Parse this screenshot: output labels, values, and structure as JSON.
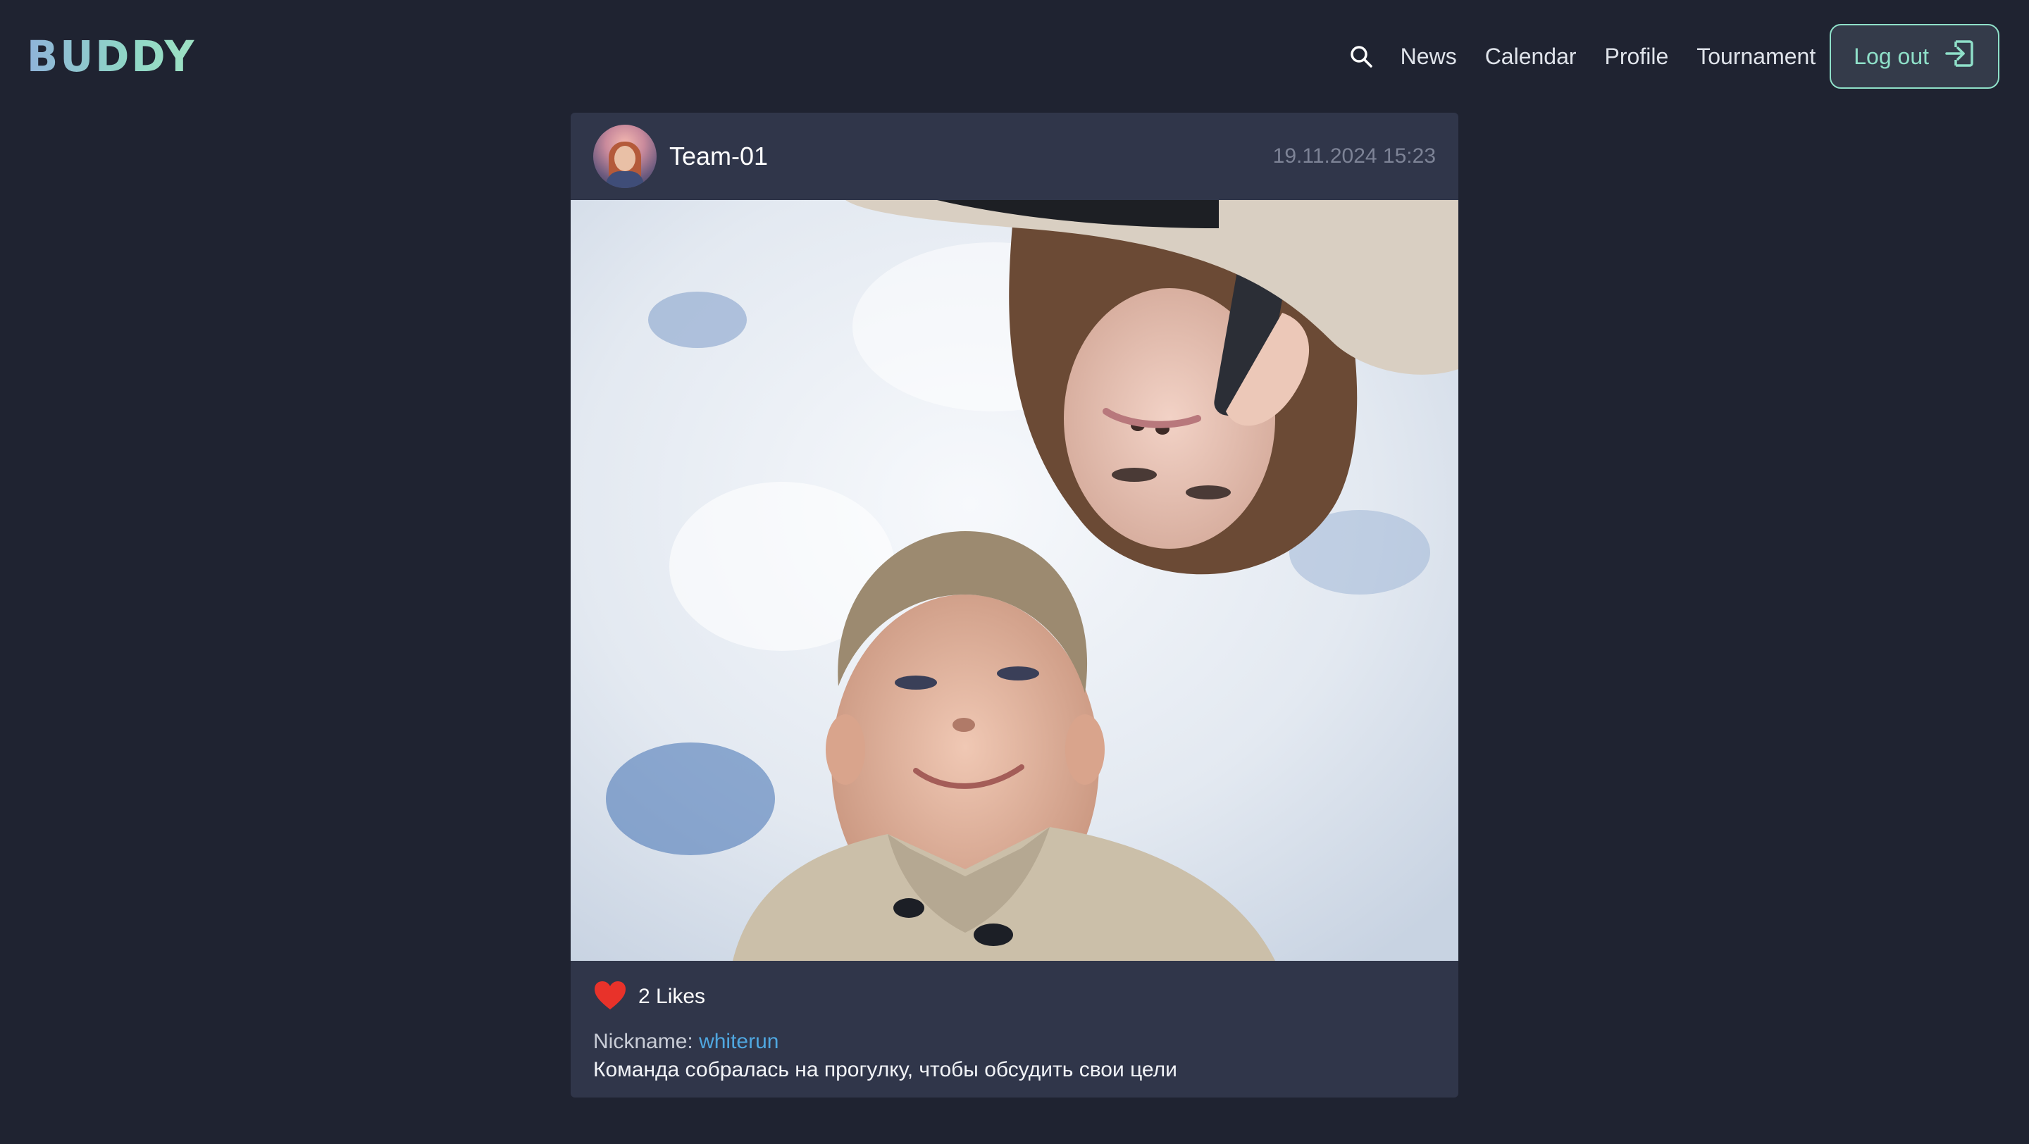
{
  "app": {
    "logo": "BUDDY"
  },
  "nav": {
    "search_icon": "search-icon",
    "links": [
      "News",
      "Calendar",
      "Profile",
      "Tournament"
    ],
    "logout_label": "Log out",
    "logout_icon": "logout-icon"
  },
  "post": {
    "author": "Team-01",
    "date": "19.11.2024 15:23",
    "likes_text": "2 Likes",
    "nickname_label": "Nickname:",
    "nickname_value": "whiterun",
    "caption": "Команда собралась на прогулку, чтобы обсудить свои цели"
  },
  "colors": {
    "background": "#1f2331",
    "card": "#30364a",
    "accent": "#8fe0c9",
    "link": "#4fa7e0",
    "like": "#e8322a"
  }
}
